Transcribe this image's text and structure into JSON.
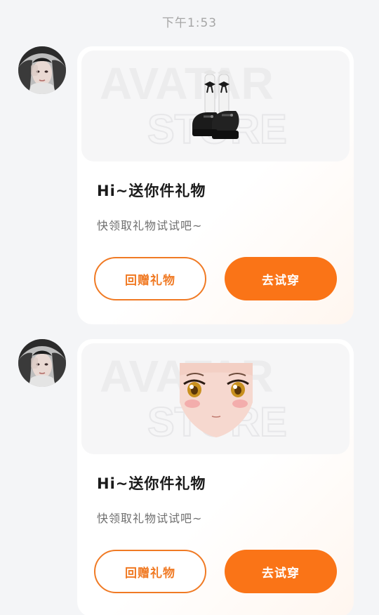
{
  "timestamp": "下午1:53",
  "colors": {
    "accent": "#fa7417",
    "accent_outline": "#f07a24",
    "background": "#f4f5f7",
    "card": "#ffffff"
  },
  "messages": [
    {
      "gift_icon": "shoes-gift-icon",
      "watermark_text": [
        "AVATAR",
        "STORE"
      ],
      "title": "Hi~送你件礼物",
      "subtitle": "快领取礼物试试吧~",
      "return_gift_label": "回赠礼物",
      "try_on_label": "去试穿"
    },
    {
      "gift_icon": "face-gift-icon",
      "watermark_text": [
        "AVATAR",
        "STORE"
      ],
      "title": "Hi~送你件礼物",
      "subtitle": "快领取礼物试试吧~",
      "return_gift_label": "回赠礼物",
      "try_on_label": "去试穿"
    }
  ]
}
